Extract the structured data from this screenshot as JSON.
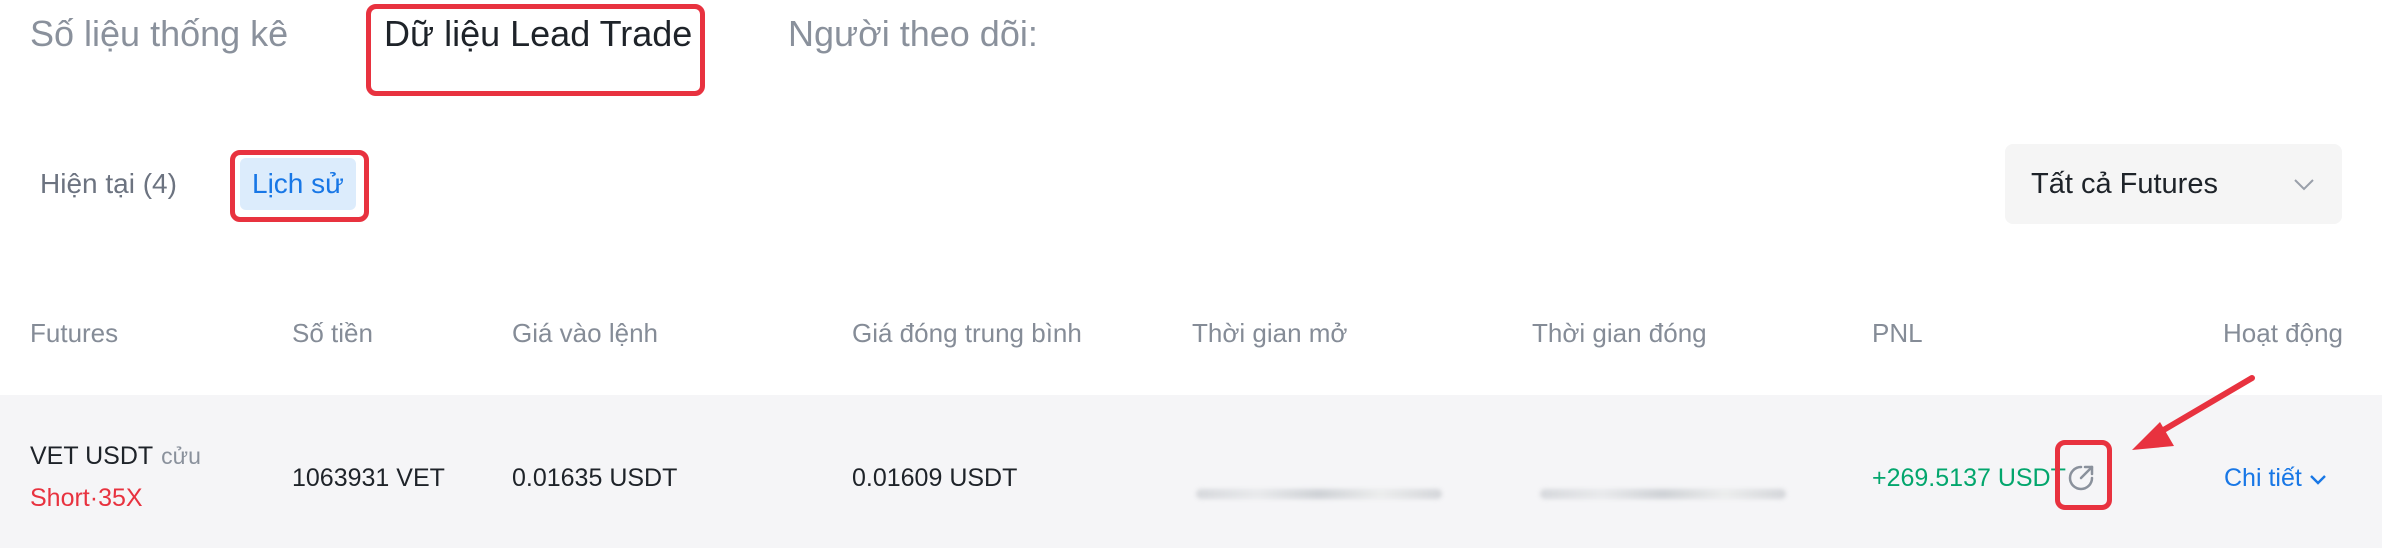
{
  "top_tabs": [
    {
      "label": "Số liệu thống kê",
      "active": false
    },
    {
      "label": "Dữ liệu Lead Trade",
      "active": true
    },
    {
      "label": "Người theo dõi:",
      "active": false
    }
  ],
  "sub_tabs": [
    {
      "label": "Hiện tại (4)",
      "active": false
    },
    {
      "label": "Lịch sử",
      "active": true
    }
  ],
  "filter": {
    "selected": "Tất cả Futures"
  },
  "table": {
    "headers": [
      "Futures",
      "Số tiền",
      "Giá vào lệnh",
      "Giá đóng trung bình",
      "Thời gian mở",
      "Thời gian đóng",
      "PNL",
      "Hoạt động"
    ],
    "rows": [
      {
        "symbol": "VET USDT",
        "symbol_tag": "cửu",
        "side": "Short·35X",
        "amount": "1063931 VET",
        "entry_price": "0.01635 USDT",
        "avg_close_price": "0.01609 USDT",
        "pnl": "+269.5137 USDT",
        "action": "Chi tiết"
      }
    ]
  },
  "colors": {
    "highlight": "#e8323f",
    "accent_blue": "#1877e6",
    "positive": "#03a66d",
    "negative": "#e8323f"
  },
  "icons": [
    "share-icon",
    "chevron-down-icon"
  ]
}
